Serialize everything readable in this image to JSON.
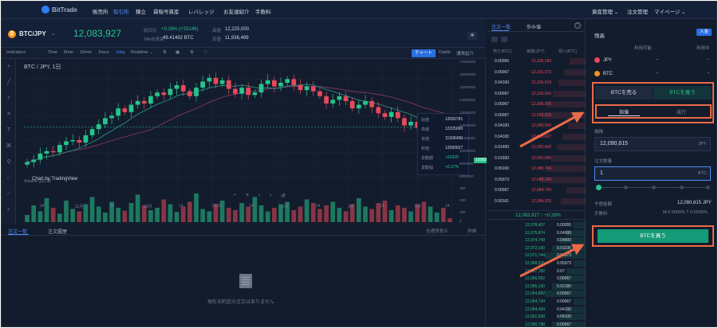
{
  "nav": {
    "logo": "BitTrade",
    "items": [
      "販売所",
      "取引所",
      "積立",
      "貸暗号資産",
      "レバレッジ",
      "お友達紹介",
      "手数料"
    ],
    "active_index": 1,
    "right": [
      "資産管理 ⌄",
      "注文管理",
      "マイページ ⌄"
    ]
  },
  "ticker": {
    "pair": "BTC/JPY",
    "caret": "⌄",
    "last_price": "12,083,927",
    "change_label": "前日比",
    "change_value": "+0.28% (+33146)",
    "volume_label": "24h出来高",
    "volume_value": "49.41492 BTC",
    "high_label": "高値",
    "high_value": "12,225,000",
    "low_label": "安値",
    "low_value": "11,936,499"
  },
  "toolbar": {
    "indicators": "Indicators",
    "times": [
      "Time",
      "5min",
      "15min",
      "1hour",
      "1day",
      "Realtime ⌄"
    ],
    "active_time": "1day",
    "chart_btn": "チャート",
    "depth": "Depth",
    "info": "通貨紹介"
  },
  "chart_data": {
    "type": "candlestick",
    "title": "BTC / JPY, 1日",
    "x_ticks": [
      "14",
      "11月",
      "14",
      "12月",
      "14",
      "2023",
      "14",
      "2月",
      "14",
      "3月",
      "14",
      "4月",
      "14"
    ],
    "y_ticks": [
      "17000000",
      "16000000",
      "15000000",
      "14000000",
      "13000000",
      "12000000",
      "11000000",
      "10000000",
      "9000000",
      "8000000"
    ],
    "volume_y_ticks": [
      "300",
      "200",
      "100",
      "0"
    ],
    "volume_label": "Volume (20)",
    "volume_value": "32",
    "ohlc": [
      {
        "label": "始値",
        "value": "12050781"
      },
      {
        "label": "高値",
        "value": "12225000"
      },
      {
        "label": "安値",
        "value": "11936499"
      },
      {
        "label": "終値",
        "value": "12083927"
      },
      {
        "label": "変動額",
        "value": "+32925"
      },
      {
        "label": "変動幅",
        "value": "+0.27%"
      }
    ],
    "price_tag": "12083927",
    "closes": [
      9.2,
      9.4,
      9.9,
      10.1,
      10.0,
      10.6,
      10.9,
      11.0,
      10.8,
      11.4,
      11.9,
      12.3,
      12.8,
      13.0,
      13.6,
      13.3,
      13.9,
      14.2,
      14.0,
      14.6,
      14.9,
      14.7,
      15.2,
      15.5,
      15.0,
      14.6,
      15.3,
      15.8,
      16.1,
      15.6,
      15.9,
      15.2,
      14.8,
      15.3,
      14.7,
      14.9,
      15.6,
      15.9,
      15.4,
      15.7,
      16.0,
      15.5,
      15.1,
      15.4,
      15.0,
      14.6,
      14.0,
      14.3,
      14.6,
      14.2,
      13.6,
      13.9,
      14.2,
      13.7,
      13.2,
      12.9,
      13.3,
      12.8,
      12.2,
      12.5,
      12.0,
      11.7,
      12.1,
      12.5,
      12.2,
      12.08
    ],
    "volumes": [
      60,
      140,
      90,
      200,
      120,
      70,
      180,
      110,
      90,
      150,
      210,
      130,
      80,
      170,
      120,
      95,
      160,
      230,
      140,
      100,
      120,
      190,
      150,
      85,
      130,
      170,
      240,
      110,
      90,
      150,
      180,
      120,
      100,
      160,
      130,
      210,
      140,
      90,
      120,
      150,
      170,
      100,
      130,
      190,
      160,
      110,
      140,
      170,
      120,
      90,
      150,
      200,
      130,
      110,
      160,
      180,
      100,
      140,
      120,
      90,
      150,
      170,
      130,
      80,
      120,
      32
    ],
    "ylim": [
      8000000,
      17000000
    ]
  },
  "chart_legend": "BTC / JPY, 1日",
  "tv_brand": "Chart by TradingView",
  "orders": {
    "tabs": [
      "注文一覧",
      "注文履歴"
    ],
    "all_show": "全通貨表示",
    "history": "詳細",
    "empty": "現在未約定の注文はありません"
  },
  "book": {
    "tabs": [
      "注文一覧",
      "歩み値"
    ],
    "info": "?",
    "headers": [
      "売り(BTC)",
      "価格(JPY)",
      "買い(BTC)"
    ],
    "asks": [
      {
        "amt": "0.00066",
        "px": "12,105,183"
      },
      {
        "amt": "0.00067",
        "px": "12,101,073"
      },
      {
        "amt": "0.04100",
        "px": "12,100,518"
      },
      {
        "amt": "0.00067",
        "px": "12,100,506"
      },
      {
        "amt": "0.00067",
        "px": "12,098,800"
      },
      {
        "amt": "0.00067",
        "px": "12,096,628"
      },
      {
        "amt": "0.04100",
        "px": "12,096,000"
      },
      {
        "amt": "0.04100",
        "px": "12,093,437"
      },
      {
        "amt": "0.01400",
        "px": "12,092,442"
      },
      {
        "amt": "0.01500",
        "px": "12,092,080"
      },
      {
        "amt": "0.06100",
        "px": "12,088,744"
      },
      {
        "amt": "0.05973",
        "px": "12,088,143"
      },
      {
        "amt": "0.00067",
        "px": "12,084,700"
      },
      {
        "amt": "0.00161",
        "px": "12,084,325"
      }
    ],
    "mid": "12,083,927 ↑ +0.28%",
    "bids": [
      {
        "px": "12,078,407",
        "amt": "0.00055"
      },
      {
        "px": "12,075,874",
        "amt": "0.04999"
      },
      {
        "px": "12,074,749",
        "amt": "0.04900"
      },
      {
        "px": "12,072,190",
        "amt": "0.01100"
      },
      {
        "px": "12,071,744",
        "amt": "0.04973"
      },
      {
        "px": "12,068,925",
        "amt": "0.05973"
      },
      {
        "px": "12,067,782",
        "amt": "0.07"
      },
      {
        "px": "12,066,562",
        "amt": "0.00067"
      },
      {
        "px": "12,065,150",
        "amt": "0.02180"
      },
      {
        "px": "12,064,882",
        "amt": "0.00067"
      },
      {
        "px": "12,064,734",
        "amt": "0.00067"
      },
      {
        "px": "12,064,494",
        "amt": "0.04100"
      },
      {
        "px": "12,061,558",
        "amt": "0.04100"
      },
      {
        "px": "12,060,788",
        "amt": "0.00067"
      }
    ]
  },
  "trade": {
    "title": "残高",
    "deposit": "入金",
    "available": "利用可能",
    "in_use": "利用中",
    "balances": [
      {
        "coin": "JPY",
        "available": "-",
        "in_use": "-",
        "color": "#e64a5a"
      },
      {
        "coin": "BTC",
        "available": "-",
        "in_use": "-",
        "color": "#f7931a"
      }
    ],
    "sell_tab": "BTCを売る",
    "buy_tab": "BTCを買う",
    "limit": "指値",
    "market": "成行",
    "price_label": "価格",
    "price_value": "12,090,615",
    "price_unit": "JPY",
    "qty_label": "注文数量",
    "qty_value": "1",
    "qty_unit": "BTC",
    "slider_fraction": 0,
    "est_label": "予想金額",
    "est_value": "12,090,615 JPY",
    "fee_label": "手数料",
    "fee_value": "M 0.0000% T 0.0000%",
    "buy_button": "BTCを買う",
    "highlight_color": "#ea6a47"
  }
}
